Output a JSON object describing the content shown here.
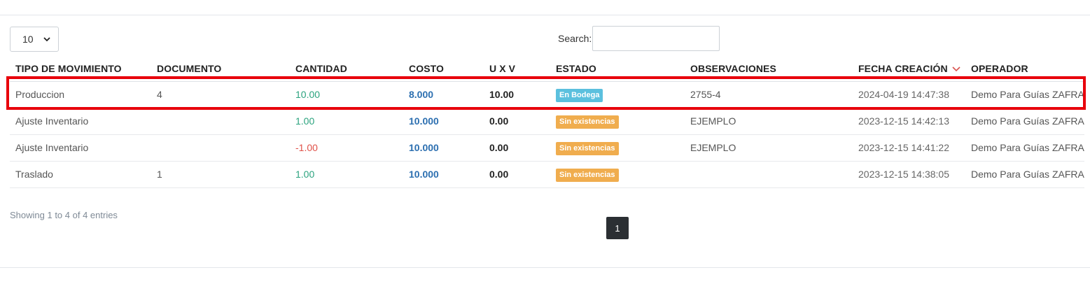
{
  "controls": {
    "length_value": "10",
    "search_label": "Search:",
    "search_value": "",
    "search_placeholder": ""
  },
  "table": {
    "headers": {
      "tipo": "TIPO DE MOVIMIENTO",
      "documento": "DOCUMENTO",
      "cantidad": "CANTIDAD",
      "costo": "COSTO",
      "uxv": "U X V",
      "estado": "ESTADO",
      "observaciones": "OBSERVACIONES",
      "fecha": "FECHA CREACIÓN",
      "operador": "OPERADOR"
    },
    "sorted_column": "fecha",
    "sort_direction": "desc",
    "rows": [
      {
        "tipo": "Produccion",
        "documento": "4",
        "cantidad": "10.00",
        "costo": "8.000",
        "uxv": "10.00",
        "estado": "En Bodega",
        "observaciones": "2755-4",
        "fecha": "2024-04-19 14:47:38",
        "operador": "Demo Para Guías ZAFRA"
      },
      {
        "tipo": "Ajuste Inventario",
        "documento": "",
        "cantidad": "1.00",
        "costo": "10.000",
        "uxv": "0.00",
        "estado": "Sin existencias",
        "observaciones": "EJEMPLO",
        "fecha": "2023-12-15 14:42:13",
        "operador": "Demo Para Guías ZAFRA"
      },
      {
        "tipo": "Ajuste Inventario",
        "documento": "",
        "cantidad": "-1.00",
        "costo": "10.000",
        "uxv": "0.00",
        "estado": "Sin existencias",
        "observaciones": "EJEMPLO",
        "fecha": "2023-12-15 14:41:22",
        "operador": "Demo Para Guías ZAFRA"
      },
      {
        "tipo": "Traslado",
        "documento": "1",
        "cantidad": "1.00",
        "costo": "10.000",
        "uxv": "0.00",
        "estado": "Sin existencias",
        "observaciones": "",
        "fecha": "2023-12-15 14:38:05",
        "operador": "Demo Para Guías ZAFRA"
      }
    ]
  },
  "footer": {
    "info": "Showing 1 to 4 of 4 entries",
    "current_page": "1"
  },
  "colors": {
    "highlight": "#e8000b",
    "badge_en_bodega": "#5bc0de",
    "badge_sin_existencias": "#f0ad4e",
    "cantidad_positive": "#2ba37e",
    "cantidad_negative": "#e0524a",
    "costo": "#2c6fb0"
  }
}
